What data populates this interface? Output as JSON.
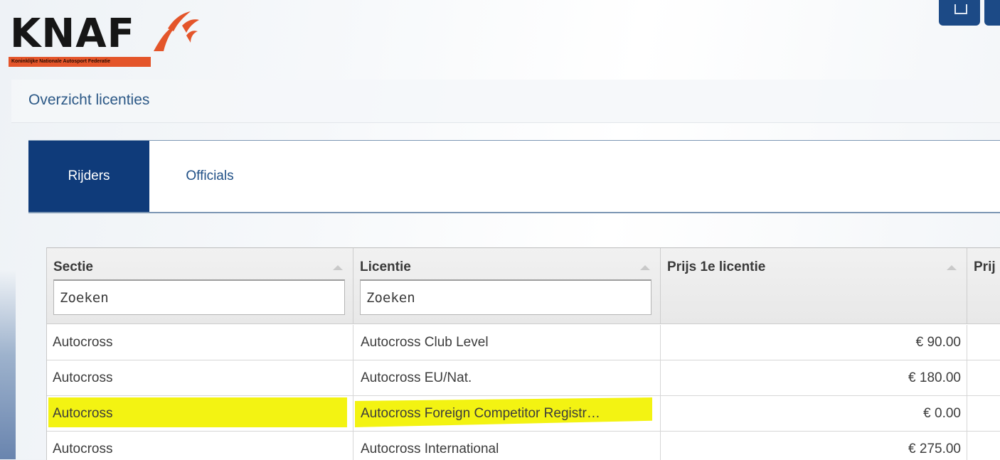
{
  "header": {
    "logo": {
      "text": "KNAF",
      "subtitle": "Koninklijke Nationale Autosport Federatie"
    }
  },
  "page": {
    "title": "Overzicht licenties"
  },
  "tabs": [
    {
      "label": "Rijders",
      "active": true
    },
    {
      "label": "Officials",
      "active": false
    }
  ],
  "grid": {
    "columns": [
      {
        "label": "Sectie",
        "search_placeholder": "Zoeken"
      },
      {
        "label": "Licentie",
        "search_placeholder": "Zoeken"
      },
      {
        "label": "Prijs 1e licentie"
      },
      {
        "label": "Prij"
      }
    ],
    "rows": [
      {
        "sectie": "Autocross",
        "licentie": "Autocross Club Level",
        "prijs": "€ 90.00",
        "highlighted": false
      },
      {
        "sectie": "Autocross",
        "licentie": "Autocross EU/Nat.",
        "prijs": "€ 180.00",
        "highlighted": false
      },
      {
        "sectie": "Autocross",
        "licentie": "Autocross Foreign Competitor Registr…",
        "prijs": "€ 0.00",
        "highlighted": true
      },
      {
        "sectie": "Autocross",
        "licentie": "Autocross International",
        "prijs": "€ 275.00",
        "highlighted": false
      }
    ]
  },
  "colors": {
    "brand_navy": "#0f3b7a",
    "logo_orange": "#e4552a",
    "highlight_yellow": "#f3f312",
    "title_blue": "#2b5886"
  }
}
